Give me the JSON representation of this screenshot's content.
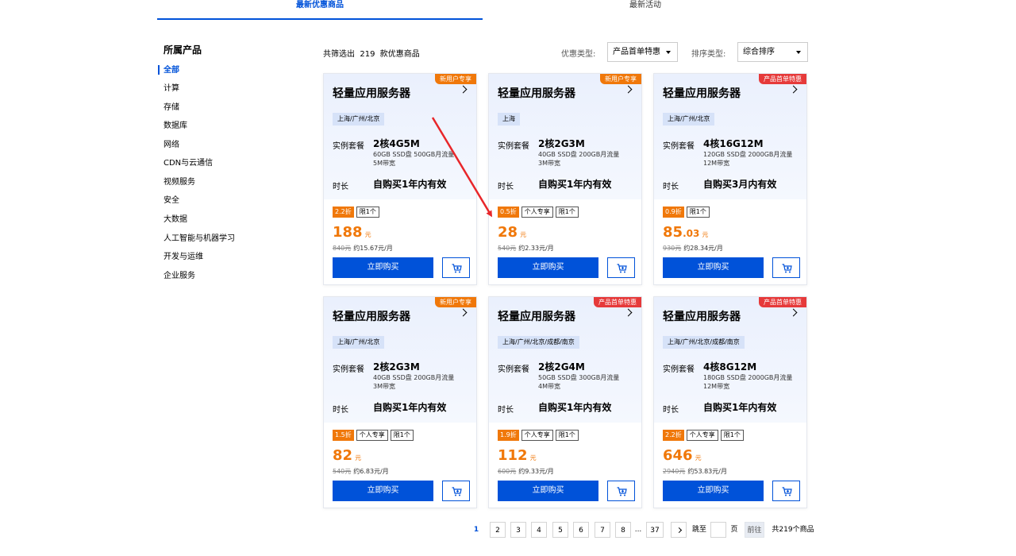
{
  "top_tabs": {
    "tab_1": "最新优惠商品",
    "tab_2": "最新活动"
  },
  "sidebar": {
    "title": "所属产品",
    "items": [
      "全部",
      "计算",
      "存储",
      "数据库",
      "网络",
      "CDN与云通信",
      "视频服务",
      "安全",
      "大数据",
      "人工智能与机器学习",
      "开发与运维",
      "企业服务"
    ]
  },
  "toolbar": {
    "result_count": "共筛选出  219  款优惠商品",
    "discount_type_label": "优惠类型:",
    "discount_type_value": "产品首单特惠",
    "sort_label": "排序类型:",
    "sort_value": "综合排序"
  },
  "colors": {
    "accent_blue": "#0052d9",
    "price_orange": "#f0780a",
    "badge_red": "#e63a3a",
    "annotation_red": "#e8262a"
  },
  "cards": [
    {
      "badge": "新用户专享",
      "badge_color": "orange",
      "title": "轻量应用服务器",
      "region": "上海/广州/北京",
      "spec_label": "实例套餐",
      "spec": "2核4G5M",
      "spec_detail_1": "60GB SSD盘 500GB月流量",
      "spec_detail_2": "5M带宽",
      "duration_label": "时长",
      "duration": "自购买1年内有效",
      "discount": "2.2折",
      "tags": [
        "限1个"
      ],
      "price": "188",
      "price_unit": "元",
      "original_price": "840元",
      "monthly": "约15.67元/月",
      "buy_label": "立即购买"
    },
    {
      "badge": "新用户专享",
      "badge_color": "orange",
      "title": "轻量应用服务器",
      "region": "上海",
      "spec_label": "实例套餐",
      "spec": "2核2G3M",
      "spec_detail_1": "40GB SSD盘 200GB月流量",
      "spec_detail_2": "3M带宽",
      "duration_label": "时长",
      "duration": "自购买1年内有效",
      "discount": "0.5折",
      "tags": [
        "个人专享",
        "限1个"
      ],
      "price": "28",
      "price_unit": "元",
      "original_price": "540元",
      "monthly": "约2.33元/月",
      "buy_label": "立即购买"
    },
    {
      "badge": "产品首单特惠",
      "badge_color": "red",
      "title": "轻量应用服务器",
      "region": "上海/广州/北京",
      "spec_label": "实例套餐",
      "spec": "4核16G12M",
      "spec_detail_1": "120GB SSD盘 2000GB月流量",
      "spec_detail_2": "12M带宽",
      "duration_label": "时长",
      "duration": "自购买3月内有效",
      "discount": "0.9折",
      "tags": [
        "限1个"
      ],
      "price": "85",
      "price_decimal": ".03",
      "price_unit": "元",
      "original_price": "930元",
      "monthly": "约28.34元/月",
      "buy_label": "立即购买"
    },
    {
      "badge": "新用户专享",
      "badge_color": "orange",
      "title": "轻量应用服务器",
      "region": "上海/广州/北京",
      "spec_label": "实例套餐",
      "spec": "2核2G3M",
      "spec_detail_1": "40GB SSD盘 200GB月流量",
      "spec_detail_2": "3M带宽",
      "duration_label": "时长",
      "duration": "自购买1年内有效",
      "discount": "1.5折",
      "tags": [
        "个人专享",
        "限1个"
      ],
      "price": "82",
      "price_unit": "元",
      "original_price": "540元",
      "monthly": "约6.83元/月",
      "buy_label": "立即购买"
    },
    {
      "badge": "产品首单特惠",
      "badge_color": "red",
      "title": "轻量应用服务器",
      "region": "上海/广州/北京/成都/南京",
      "spec_label": "实例套餐",
      "spec": "2核2G4M",
      "spec_detail_1": "50GB SSD盘 300GB月流量",
      "spec_detail_2": "4M带宽",
      "duration_label": "时长",
      "duration": "自购买1年内有效",
      "discount": "1.9折",
      "tags": [
        "个人专享",
        "限1个"
      ],
      "price": "112",
      "price_unit": "元",
      "original_price": "600元",
      "monthly": "约9.33元/月",
      "buy_label": "立即购买"
    },
    {
      "badge": "产品首单特惠",
      "badge_color": "red",
      "title": "轻量应用服务器",
      "region": "上海/广州/北京/成都/南京",
      "spec_label": "实例套餐",
      "spec": "4核8G12M",
      "spec_detail_1": "180GB SSD盘 2000GB月流量",
      "spec_detail_2": "12M带宽",
      "duration_label": "时长",
      "duration": "自购买1年内有效",
      "discount": "2.2折",
      "tags": [
        "个人专享",
        "限1个"
      ],
      "price": "646",
      "price_unit": "元",
      "original_price": "2940元",
      "monthly": "约53.83元/月",
      "buy_label": "立即购买"
    }
  ],
  "pagination": {
    "current": "1",
    "pages": [
      "2",
      "3",
      "4",
      "5",
      "6",
      "7",
      "8"
    ],
    "ellipsis": "...",
    "last": "37",
    "goto_label": "跳至",
    "page_unit": "页",
    "go_button": "前往",
    "total": "共219个商品"
  }
}
